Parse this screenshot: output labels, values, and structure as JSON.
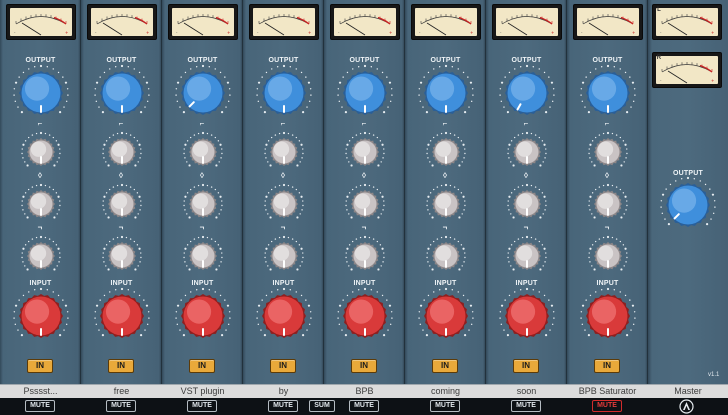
{
  "channels": [
    {
      "name": "Psssst...",
      "mute_label": "MUTE",
      "mute_active": false
    },
    {
      "name": "free",
      "mute_label": "MUTE",
      "mute_active": false
    },
    {
      "name": "VST plugin",
      "mute_label": "MUTE",
      "mute_active": false
    },
    {
      "name": "by",
      "mute_label": "MUTE",
      "mute_active": false
    },
    {
      "name": "BPB",
      "mute_label": "MUTE",
      "mute_active": false
    },
    {
      "name": "coming",
      "mute_label": "MUTE",
      "mute_active": false
    },
    {
      "name": "soon",
      "mute_label": "MUTE",
      "mute_active": false
    },
    {
      "name": "BPB Saturator",
      "mute_label": "MUTE",
      "mute_active": true
    }
  ],
  "labels": {
    "output": "OUTPUT",
    "input": "INPUT",
    "in_button": "IN",
    "sum_button": "SUM"
  },
  "master": {
    "name": "Master",
    "output_label": "OUTPUT",
    "meter_left": "L",
    "meter_right": "R",
    "version": "v1.1"
  },
  "icons": {
    "low_eq": "low-shelf-icon",
    "mid_eq": "mid-bell-icon",
    "high_eq": "high-shelf-icon",
    "logo": "bpb-logo-icon"
  },
  "colors": {
    "panel": "#4d6a7e",
    "output_knob": "#3f8fdc",
    "input_knob": "#d93a3a",
    "eq_knob": "#c9c3c4",
    "in_button": "#e9a93a",
    "meter_face": "#f2e7c6",
    "meter_red": "#c82222",
    "mute_active": "#d22c2c"
  }
}
